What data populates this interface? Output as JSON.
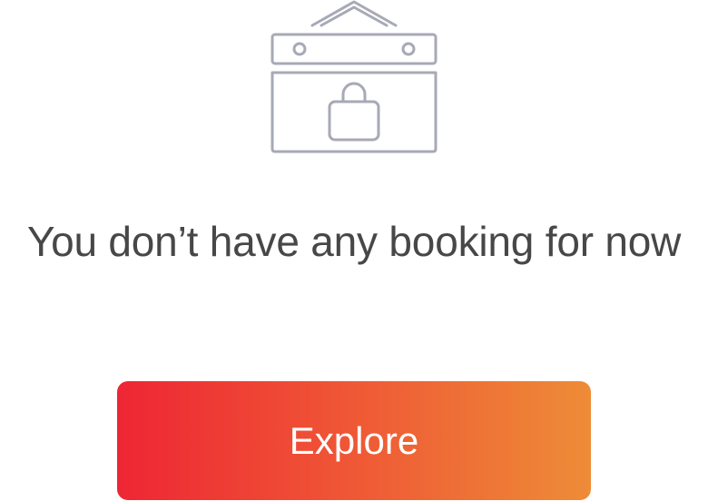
{
  "empty_state": {
    "icon": "closed-shop-sign-lock-icon",
    "message": "You don’t have any booking for now",
    "explore_label": "Explore"
  },
  "colors": {
    "icon_stroke": "#a7a9b6",
    "message_text": "#474747",
    "button_gradient_start": "#ee2634",
    "button_gradient_end": "#ee8c37",
    "button_text": "#ffffff"
  }
}
